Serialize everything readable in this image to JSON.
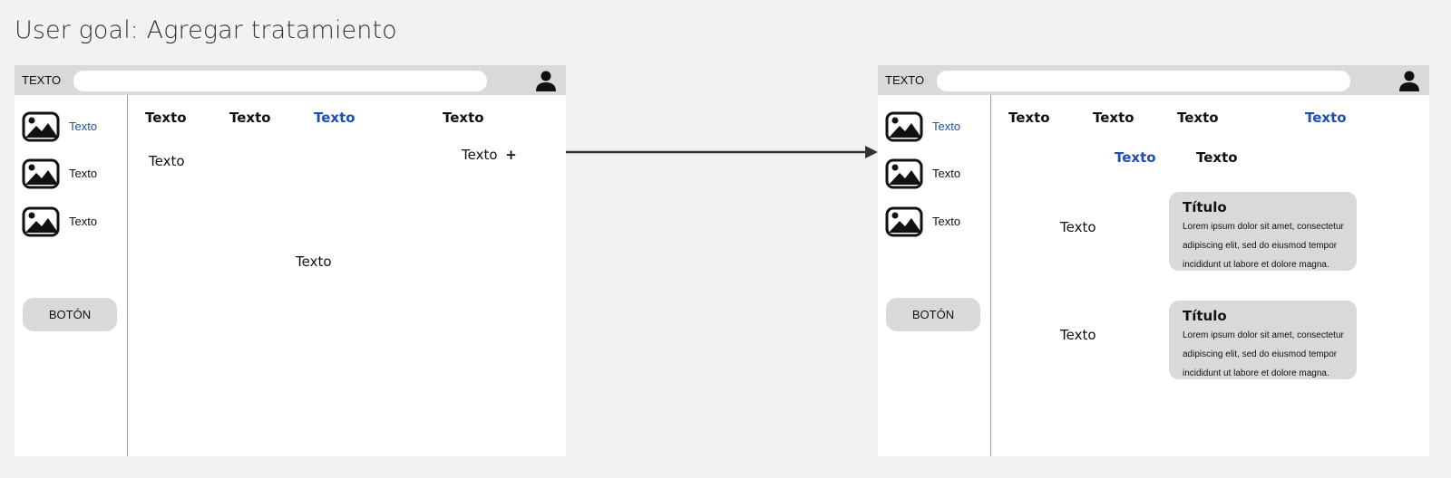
{
  "header": {
    "title": "User goal: Agregar tratamiento"
  },
  "screens": {
    "before": {
      "topbar": {
        "brand": "TEXTO",
        "search_placeholder": ""
      },
      "sidebar": {
        "items": [
          {
            "label": "Texto",
            "icon": "image-icon"
          },
          {
            "label": "Texto",
            "icon": "image-icon"
          },
          {
            "label": "Texto",
            "icon": "image-icon"
          }
        ],
        "button": "BOTÓN"
      },
      "tabs": [
        "Texto",
        "Texto",
        "Texto",
        "Texto"
      ],
      "content": {
        "left_label": "Texto",
        "add_label": "Texto",
        "add_symbol": "+",
        "center_label": "Texto"
      }
    },
    "after": {
      "topbar": {
        "brand": "TEXTO",
        "search_placeholder": ""
      },
      "sidebar": {
        "items": [
          {
            "label": "Texto",
            "icon": "image-icon"
          },
          {
            "label": "Texto",
            "icon": "image-icon"
          },
          {
            "label": "Texto",
            "icon": "image-icon"
          }
        ],
        "button": "BOTÓN"
      },
      "tabs": [
        "Texto",
        "Texto",
        "Texto",
        "Texto"
      ],
      "subtabs": [
        "Texto",
        "Texto"
      ],
      "entries": [
        {
          "label": "Texto",
          "card_title": "Título",
          "card_body": "Lorem ipsum dolor sit amet, consectetur adipiscing elit, sed do eiusmod tempor incididunt ut labore et dolore magna."
        },
        {
          "label": "Texto",
          "card_title": "Título",
          "card_body": "Lorem ipsum dolor sit amet, consectetur adipiscing elit, sed do eiusmod tempor incididunt ut labore et dolore magna."
        }
      ]
    }
  },
  "colors": {
    "accent": "#1c4fb1",
    "topbar": "#d9d9d9",
    "background": "#f2f2f2"
  }
}
